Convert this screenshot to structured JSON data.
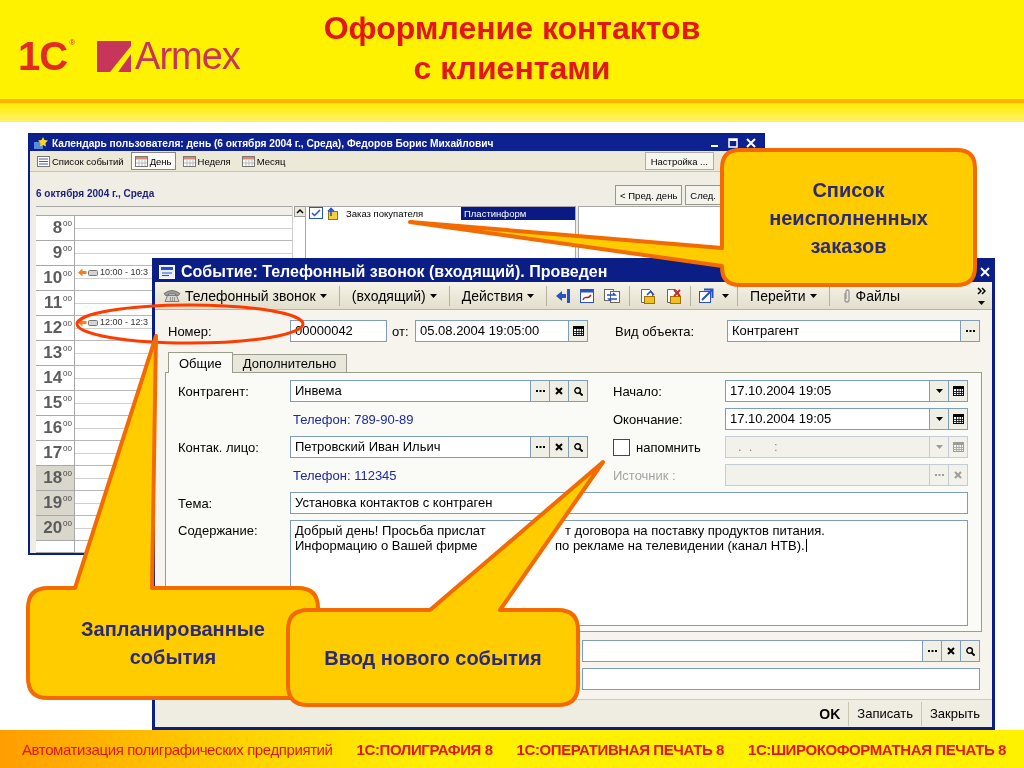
{
  "header": {
    "logo_1c": "1С",
    "logo_1c_mark": "®",
    "logo_armex": "Armex",
    "title_lines": [
      "Оформление контактов",
      "с клиентами"
    ]
  },
  "calendar_window": {
    "title": "Календарь пользователя: день (6 октября 2004 г., Среда), Федоров Борис Михайлович",
    "views": [
      {
        "label": "Список событий",
        "selected": false
      },
      {
        "label": "День",
        "selected": true
      },
      {
        "label": "Неделя",
        "selected": false
      },
      {
        "label": "Месяц",
        "selected": false
      }
    ],
    "settings_button": "Настройка ...",
    "date_heading": "6 октября 2004 г., Среда",
    "nav_buttons": [
      "< Пред. день",
      "След."
    ],
    "hours": [
      {
        "hour": "8",
        "minutes": "00",
        "off_hours": false
      },
      {
        "hour": "9",
        "minutes": "00",
        "off_hours": false
      },
      {
        "hour": "10",
        "minutes": "00",
        "off_hours": false,
        "event": "10:00 - 10:3"
      },
      {
        "hour": "11",
        "minutes": "00",
        "off_hours": false
      },
      {
        "hour": "12",
        "minutes": "00",
        "off_hours": false,
        "event": "12:00 - 12:3"
      },
      {
        "hour": "13",
        "minutes": "00",
        "off_hours": false
      },
      {
        "hour": "14",
        "minutes": "00",
        "off_hours": false
      },
      {
        "hour": "15",
        "minutes": "00",
        "off_hours": false
      },
      {
        "hour": "16",
        "minutes": "00",
        "off_hours": false
      },
      {
        "hour": "17",
        "minutes": "00",
        "off_hours": false
      },
      {
        "hour": "18",
        "minutes": "00",
        "off_hours": true
      },
      {
        "hour": "19",
        "minutes": "00",
        "off_hours": true
      },
      {
        "hour": "20",
        "minutes": "00",
        "off_hours": true
      }
    ],
    "orders": [
      {
        "document": "Заказ покупателя",
        "customer": "Пластинформ",
        "selected": true
      }
    ]
  },
  "event_dialog": {
    "title": "Событие: Телефонный звонок (входящий). Проведен",
    "toolbar_menus": [
      "Телефонный звонок",
      "(входящий)",
      "Действия"
    ],
    "goto_menu": "Перейти",
    "files_button": "Файлы",
    "number": {
      "label": "Номер:",
      "value": "00000042"
    },
    "date": {
      "label": "от:",
      "value": "05.08.2004 19:05:00"
    },
    "object_type": {
      "label": "Вид объекта:",
      "value": "Контрагент"
    },
    "tabs": [
      {
        "label": "Общие",
        "selected": true
      },
      {
        "label": "Дополнительно",
        "selected": false
      }
    ],
    "counterparty": {
      "label": "Контрагент:",
      "value": "Инвема",
      "phone": "Телефон: 789-90-89"
    },
    "contact_person": {
      "label": "Контак. лицо:",
      "value": "Петровский Иван Ильич",
      "phone": "Телефон: 112345"
    },
    "start": {
      "label": "Начало:",
      "value": "17.10.2004 19:05"
    },
    "end": {
      "label": "Окончание:",
      "value": "17.10.2004 19:05"
    },
    "reminder": {
      "label": "напомнить",
      "checked": false,
      "placeholder": ".  .      :",
      "field_disabled": true
    },
    "source": {
      "label": "Источник :",
      "disabled": true
    },
    "subject": {
      "label": "Тема:",
      "value": "Установка контактов с контраген"
    },
    "content": {
      "label": "Содержание:",
      "lines": [
        {
          "before": "Добрый день! Просьба прислат",
          "after": "т договора на поставку продуктов питания."
        },
        {
          "before": "Информацию о Вашей фирме",
          "after": "по рекламе на телевидении (канал НТВ)."
        }
      ]
    },
    "buttons": [
      {
        "label": "OK",
        "default": true
      },
      {
        "label": "Записать",
        "default": false
      },
      {
        "label": "Закрыть",
        "default": false
      }
    ]
  },
  "callouts": [
    "Список неисполненных заказов",
    "Запланированные события",
    "Ввод нового события"
  ],
  "footer": {
    "tagline": "Автоматизация полиграфических предприятий",
    "products": [
      "1С:ПОЛИГРАФИЯ 8",
      "1С:ОПЕРАТИВНАЯ ПЕЧАТЬ 8",
      "1С:ШИРОКОФОРМАТНАЯ ПЕЧАТЬ 8"
    ]
  }
}
